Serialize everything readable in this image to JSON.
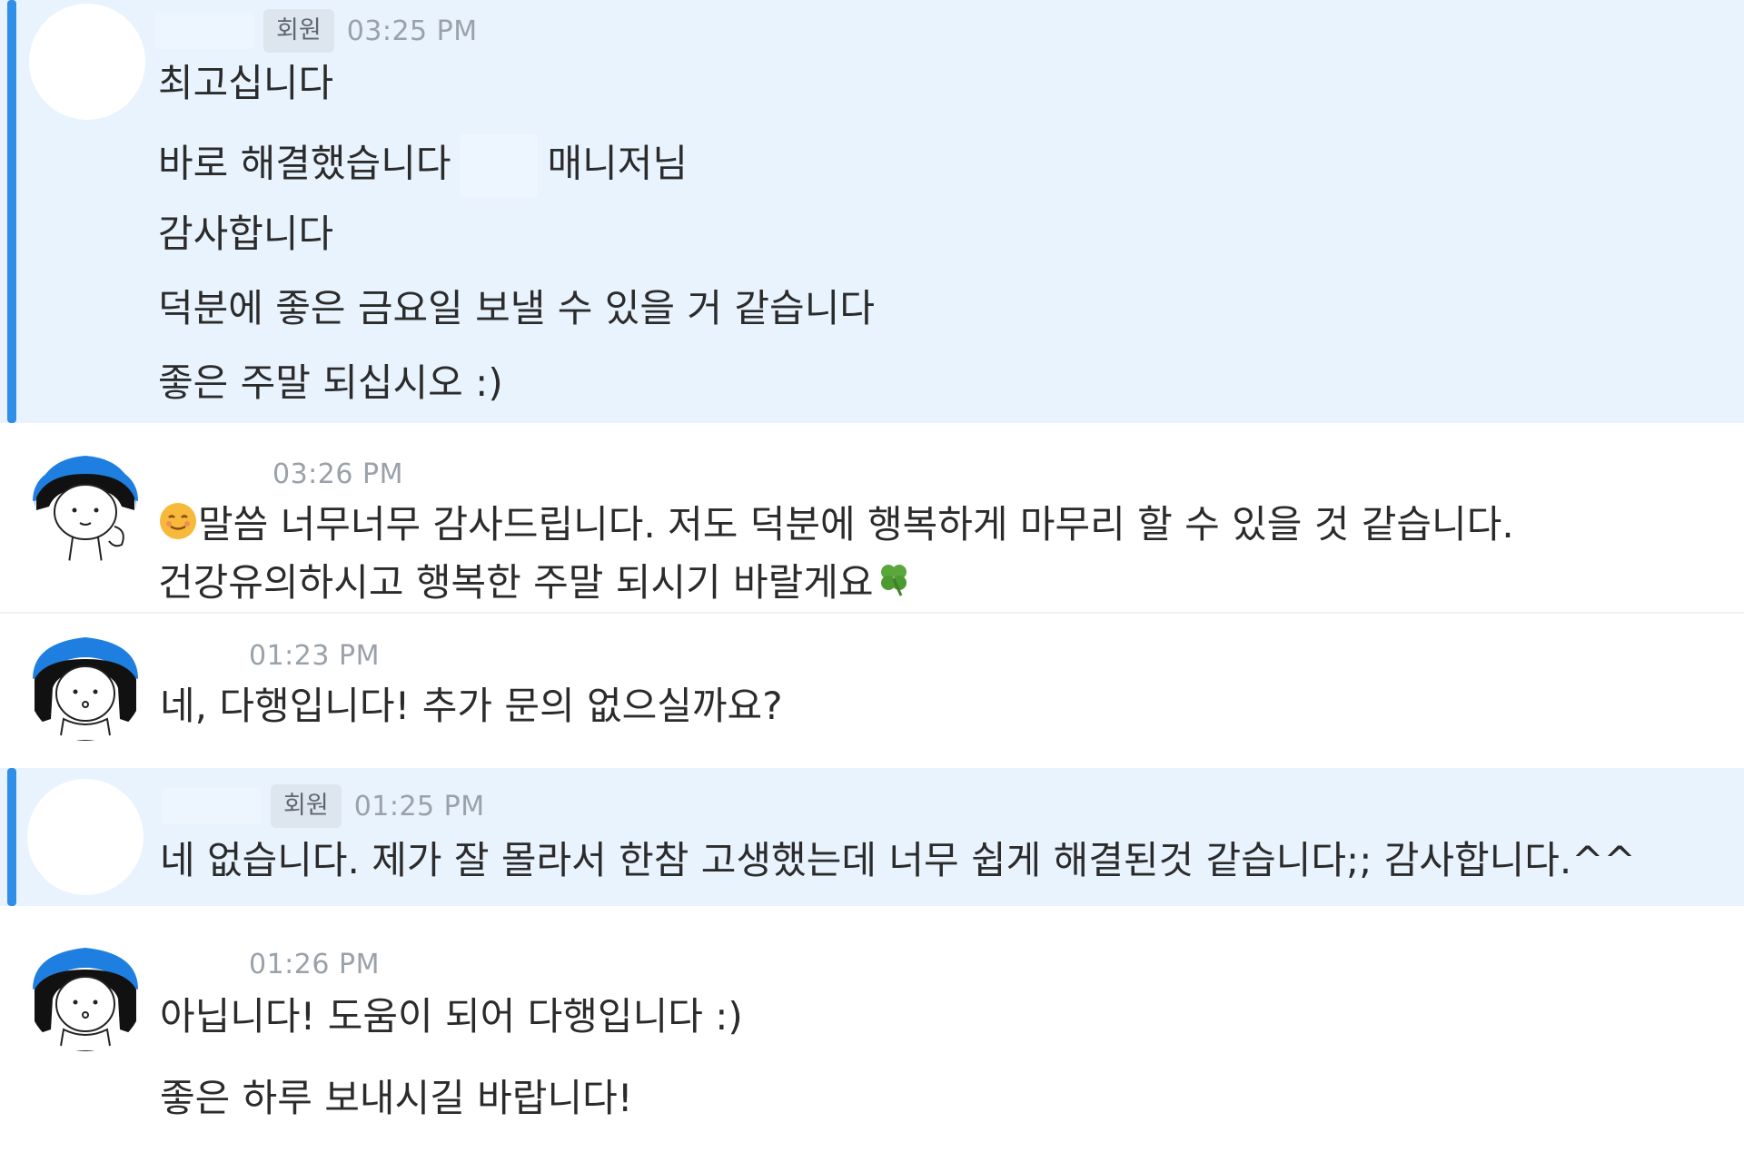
{
  "messages": [
    {
      "role": "member",
      "badge": "회원",
      "time": "03:25 PM",
      "lines": {
        "l1": "최고십니다",
        "l2a": "바로 해결했습니다",
        "l2b": "매니저님",
        "l3": "감사합니다",
        "l4": "덕분에 좋은 금요일 보낼 수 있을 거 같습니다",
        "l5": "좋은 주말 되십시오 :)"
      }
    },
    {
      "role": "manager",
      "time": "03:26 PM",
      "lines": {
        "l1": "말씀 너무너무 감사드립니다. 저도 덕분에 행복하게 마무리 할 수 있을 것 같습니다.",
        "l2": "건강유의하시고 행복한 주말 되시기 바랄게요"
      },
      "icons": {
        "lead": "smiling-face-emoji",
        "trail": "four-leaf-clover-emoji"
      }
    },
    {
      "role": "manager",
      "time": "01:23 PM",
      "lines": {
        "l1": "네, 다행입니다! 추가 문의 없으실까요?"
      }
    },
    {
      "role": "member",
      "badge": "회원",
      "time": "01:25 PM",
      "lines": {
        "l1": "네 없습니다. 제가 잘 몰라서 한참 고생했는데 너무 쉽게 해결된것 같습니다;; 감사합니다.^^"
      }
    },
    {
      "role": "manager",
      "time": "01:26 PM",
      "lines": {
        "l1": "아닙니다! 도움이 되어 다행입니다 :)",
        "l2": "좋은 하루 보내시길 바랍니다!"
      }
    }
  ],
  "colors": {
    "member_bg": "#e9f3fe",
    "accent_bar": "#2f8fe8",
    "avatar_hair_blue": "#1f7fe0",
    "text": "#2b2b2b",
    "time": "#9aa1a9"
  }
}
